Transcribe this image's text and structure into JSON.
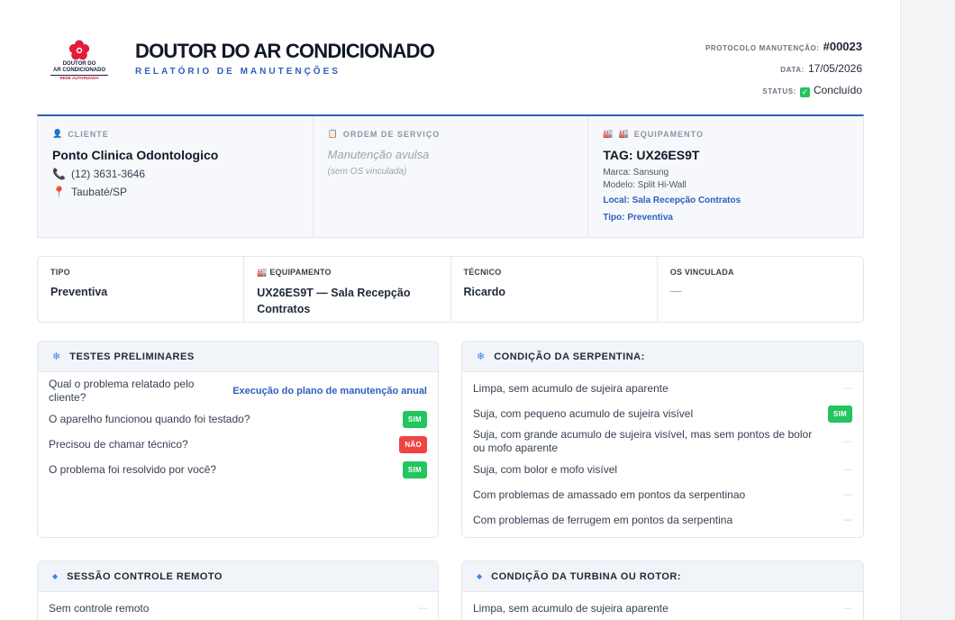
{
  "brand": {
    "logo_line1": "DOUTOR DO",
    "logo_line2": "AR CONDICIONADO",
    "logo_line3": "REDE AUTORIZADA",
    "name": "DOUTOR DO AR CONDICIONADO",
    "subtitle": "RELATÓRIO DE MANUTENÇÕES",
    "accent_color": "#2f5fbf",
    "logo_color": "#e11d3a"
  },
  "meta": {
    "protocol_label": "PROTOCOLO MANUTENÇÃO:",
    "protocol_value": "#00023",
    "date_label": "DATA:",
    "date_value": "17/05/2026",
    "status_label": "STATUS:",
    "status_value": "Concluído"
  },
  "client": {
    "header": "CLIENTE",
    "name": "Ponto Clinica Odontologico",
    "phone": "(12) 3631-3646",
    "city": "Taubaté/SP"
  },
  "service_order": {
    "header": "ORDEM DE SERVIÇO",
    "value": "Manutenção avulsa",
    "note": "(sem OS vinculada)"
  },
  "equipment": {
    "header": "EQUIPAMENTO",
    "tag": "TAG: UX26ES9T",
    "brand": "Marca: Sansung",
    "model": "Modelo: Split Hi-Wall",
    "location": "Local: Sala Recepção Contratos",
    "type": "Tipo: Preventiva"
  },
  "summary": {
    "type_label": "TIPO",
    "type_value": "Preventiva",
    "equipment_label": "EQUIPAMENTO",
    "equipment_value": "UX26ES9T — Sala Recepção Contratos",
    "tech_label": "TÉCNICO",
    "tech_value": "Ricardo",
    "os_label": "OS VINCULADA",
    "os_value": "—"
  },
  "tests": {
    "title": "TESTES PRELIMINARES",
    "rows": [
      {
        "q": "Qual o problema relatado pelo cliente?",
        "a": "Execução do plano de manutenção anual"
      },
      {
        "q": "O aparelho funcionou quando foi testado?",
        "a": "SIM"
      },
      {
        "q": "Precisou de chamar técnico?",
        "a": "NÃO"
      },
      {
        "q": "O problema foi resolvido por você?",
        "a": "SIM"
      }
    ]
  },
  "coil": {
    "title": "CONDIÇÃO DA SERPENTINA:",
    "rows": [
      {
        "q": "Limpa, sem acumulo de sujeira aparente",
        "a": "---"
      },
      {
        "q": "Suja, com pequeno acumulo de sujeira visível",
        "a": "SIM"
      },
      {
        "q": "Suja, com grande acumulo de sujeira visível, mas sem pontos de bolor ou mofo aparente",
        "a": "---"
      },
      {
        "q": "Suja, com bolor e mofo visível",
        "a": "---"
      },
      {
        "q": "Com problemas de amassado em pontos da serpentinao",
        "a": "---"
      },
      {
        "q": "Com problemas de ferrugem em pontos da serpentina",
        "a": "---"
      }
    ]
  },
  "remote": {
    "title": "SESSÃO CONTROLE REMOTO",
    "rows": [
      {
        "q": "Sem controle remoto",
        "a": "---"
      }
    ]
  },
  "turbine": {
    "title": "CONDIÇÃO DA TURBINA OU ROTOR:",
    "rows": [
      {
        "q": "Limpa, sem acumulo de sujeira aparente",
        "a": "---"
      }
    ]
  }
}
